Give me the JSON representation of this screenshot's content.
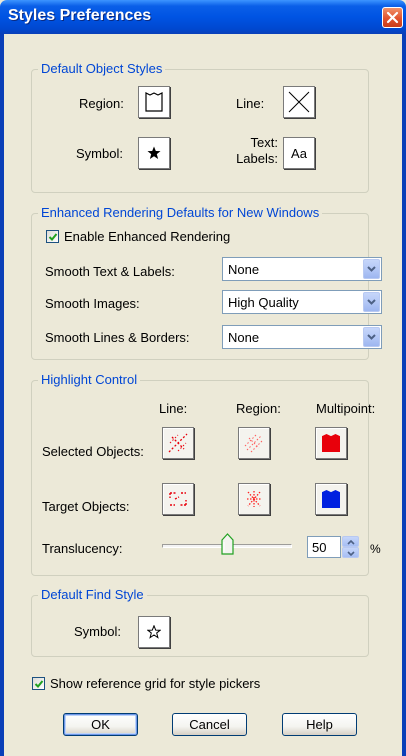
{
  "window": {
    "title": "Styles Preferences"
  },
  "default_object_styles": {
    "legend": "Default Object Styles",
    "region_label": "Region:",
    "line_label": "Line:",
    "symbol_label": "Symbol:",
    "text_labels_label_1": "Text:",
    "text_labels_label_2": "Labels:",
    "text_sample": "Aa"
  },
  "enhanced_rendering": {
    "legend": "Enhanced Rendering Defaults for New Windows",
    "enable_label": "Enable Enhanced Rendering",
    "enable_checked": true,
    "smooth_text_label": "Smooth Text & Labels:",
    "smooth_text_value": "None",
    "smooth_images_label": "Smooth Images:",
    "smooth_images_value": "High Quality",
    "smooth_lines_label": "Smooth Lines & Borders:",
    "smooth_lines_value": "None"
  },
  "highlight_control": {
    "legend": "Highlight Control",
    "col_line": "Line:",
    "col_region": "Region:",
    "col_multipoint": "Multipoint:",
    "selected_label": "Selected Objects:",
    "target_label": "Target Objects:",
    "translucency_label": "Translucency:",
    "translucency_value": "50",
    "translucency_unit": "%",
    "selected_multipoint_color": "#e8000b",
    "target_multipoint_color": "#0020e0"
  },
  "default_find_style": {
    "legend": "Default Find Style",
    "symbol_label": "Symbol:"
  },
  "reference_grid": {
    "label": "Show reference grid for style pickers",
    "checked": true
  },
  "buttons": {
    "ok": "OK",
    "cancel": "Cancel",
    "help": "Help"
  }
}
